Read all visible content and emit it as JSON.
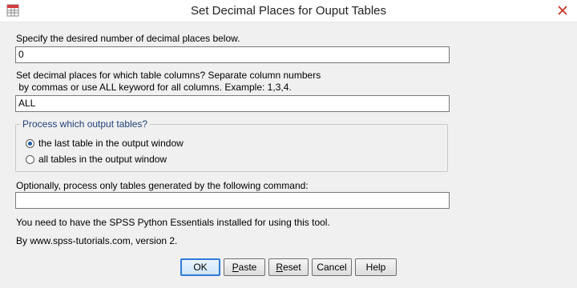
{
  "window": {
    "title": "Set Decimal Places for Ouput Tables",
    "close_icon": "close-icon",
    "app_icon": "spss-table-icon"
  },
  "form": {
    "decimal_label": "Specify the desired number of decimal places below.",
    "decimal_value": "0",
    "columns_label_line1": "Set decimal places for which table columns? Separate column numbers",
    "columns_label_line2": " by commas or use ALL keyword for all columns. Example: 1,3,4.",
    "columns_value": "ALL",
    "tables_group": {
      "legend": "Process which output tables?",
      "options": [
        {
          "label": "the last table in the output window",
          "selected": true
        },
        {
          "label": "all tables in the output window",
          "selected": false
        }
      ]
    },
    "command_label": "Optionally, process only tables generated by the following command:",
    "command_value": "",
    "note": "You need to have the SPSS Python Essentials installed for using this tool.",
    "credit": "By www.spss-tutorials.com, version 2."
  },
  "buttons": {
    "ok": "OK",
    "paste_first": "P",
    "paste_rest": "aste",
    "reset_first": "R",
    "reset_rest": "eset",
    "cancel": "Cancel",
    "help": "Help"
  },
  "colors": {
    "accent": "#2f7bd6",
    "group_legend": "#1f3f7a",
    "close_x": "#c42b1c"
  }
}
